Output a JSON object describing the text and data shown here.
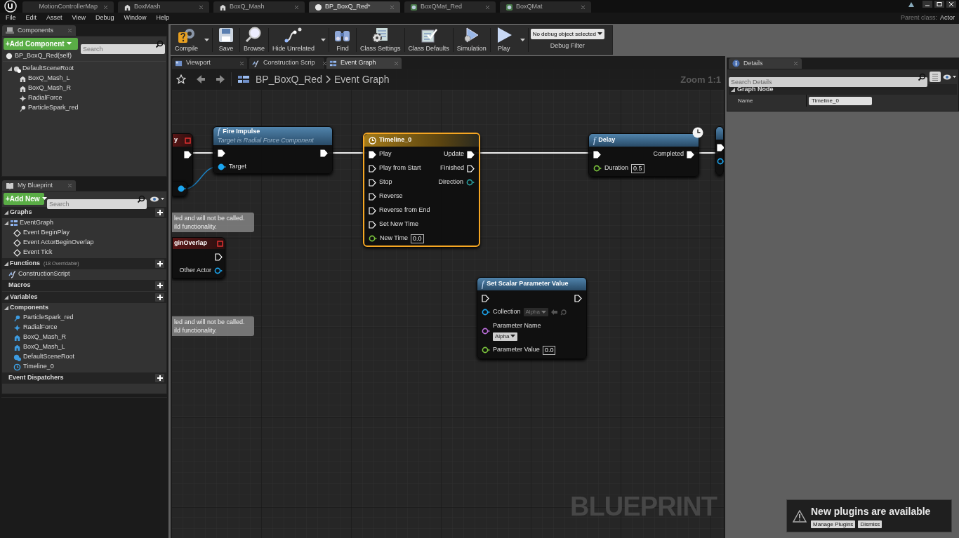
{
  "document_tabs": [
    {
      "label": "MotionControllerMap",
      "kind": "plain",
      "selected": false
    },
    {
      "label": "BoxMash",
      "kind": "mesh",
      "selected": false
    },
    {
      "label": "BoxQ_Mash",
      "kind": "mesh",
      "selected": false
    },
    {
      "label": "BP_BoxQ_Red*",
      "kind": "blueprint",
      "selected": true
    },
    {
      "label": "BoxQMat_Red",
      "kind": "material",
      "selected": false
    },
    {
      "label": "BoxQMat",
      "kind": "material",
      "selected": false
    }
  ],
  "menu": [
    "File",
    "Edit",
    "Asset",
    "View",
    "Debug",
    "Window",
    "Help"
  ],
  "parent_class": {
    "label": "Parent class:",
    "value": "Actor"
  },
  "components_panel": {
    "tab": "Components",
    "add_button": "+Add Component",
    "search_placeholder": "Search",
    "self_item": "BP_BoxQ_Red(self)",
    "tree": [
      {
        "label": "DefaultSceneRoot",
        "kind": "scene",
        "expanded": true,
        "children": [
          {
            "label": "BoxQ_Mash_L",
            "kind": "mesh"
          },
          {
            "label": "BoxQ_Mash_R",
            "kind": "mesh"
          },
          {
            "label": "RadialForce",
            "kind": "force"
          },
          {
            "label": "ParticleSpark_red",
            "kind": "particle"
          }
        ]
      }
    ]
  },
  "my_blueprint": {
    "tab": "My Blueprint",
    "add_button": "+Add New",
    "search_placeholder": "Search",
    "sections": [
      {
        "title": "Graphs",
        "expanded": true,
        "items": [
          {
            "label": "EventGraph",
            "kind": "graph",
            "expanded": true,
            "children": [
              {
                "label": "Event BeginPlay",
                "kind": "event"
              },
              {
                "label": "Event ActorBeginOverlap",
                "kind": "event"
              },
              {
                "label": "Event Tick",
                "kind": "event"
              }
            ]
          }
        ]
      },
      {
        "title": "Functions",
        "note": "(18 Overridable)",
        "expanded": true,
        "items": [
          {
            "label": "ConstructionScript",
            "kind": "function"
          }
        ]
      },
      {
        "title": "Macros"
      },
      {
        "title": "Variables",
        "expanded": true,
        "items": [
          {
            "label": "Components",
            "kind": "category",
            "expanded": true,
            "children": [
              {
                "label": "ParticleSpark_red",
                "kind": "particle"
              },
              {
                "label": "RadialForce",
                "kind": "force"
              },
              {
                "label": "BoxQ_Mash_R",
                "kind": "mesh"
              },
              {
                "label": "BoxQ_Mash_L",
                "kind": "mesh"
              },
              {
                "label": "DefaultSceneRoot",
                "kind": "scene"
              },
              {
                "label": "Timeline_0",
                "kind": "timeline"
              }
            ]
          }
        ]
      },
      {
        "title": "Event Dispatchers"
      }
    ]
  },
  "toolbar": [
    {
      "label": "Compile",
      "kind": "compile",
      "dropdown": true
    },
    {
      "label": "Save",
      "kind": "save",
      "dropdown": false
    },
    {
      "label": "Browse",
      "kind": "browse",
      "dropdown": false
    },
    {
      "label": "Hide Unrelated",
      "kind": "hide",
      "dropdown": true
    },
    {
      "label": "Find",
      "kind": "find",
      "dropdown": false
    },
    {
      "label": "Class Settings",
      "kind": "settings",
      "dropdown": false
    },
    {
      "label": "Class Defaults",
      "kind": "defaults",
      "dropdown": false
    },
    {
      "label": "Simulation",
      "kind": "simulation",
      "dropdown": false
    },
    {
      "label": "Play",
      "kind": "play",
      "dropdown": true
    }
  ],
  "debug_filter": {
    "value": "No debug object selected",
    "label": "Debug Filter"
  },
  "editor_tabs": [
    {
      "label": "Viewport",
      "kind": "viewport",
      "selected": false
    },
    {
      "label": "Construction Scrip",
      "kind": "function",
      "selected": false
    },
    {
      "label": "Event Graph",
      "kind": "graph",
      "selected": true
    }
  ],
  "breadcrumb": {
    "root": "BP_BoxQ_Red",
    "current": "Event Graph"
  },
  "zoom": "Zoom 1:1",
  "graph_nodes": [
    {
      "kind": "event",
      "title": "y",
      "selected": false,
      "rows": [
        {
          "right": {
            "kind": "exec",
            "connected": true
          }
        }
      ]
    },
    {
      "kind": "function",
      "glyph": "f",
      "title": "Fire Impulse",
      "subtitle": "Target is Radial Force Component",
      "selected": false,
      "rows": [
        {
          "left": {
            "kind": "exec",
            "connected": true
          },
          "right": {
            "kind": "exec",
            "connected": true
          }
        },
        {
          "left": {
            "kind": "object",
            "label": "Target",
            "connected": true
          }
        }
      ]
    },
    {
      "kind": "variable",
      "selected": false,
      "rows": [
        {
          "right": {
            "kind": "object",
            "connected": true
          }
        }
      ]
    },
    {
      "kind": "comment",
      "lines": [
        "led and will not be called.",
        "ild functionality."
      ]
    },
    {
      "kind": "event",
      "title": "ginOverlap",
      "selected": false,
      "rows": [
        {
          "right": {
            "kind": "exec",
            "connected": false
          }
        },
        {
          "right": {
            "kind": "object",
            "label": "Other Actor",
            "connected": false
          }
        }
      ]
    },
    {
      "kind": "comment",
      "lines": [
        "led and will not be called.",
        "ild functionality."
      ]
    },
    {
      "kind": "timeline",
      "title": "Timeline_0",
      "selected": true,
      "rows": [
        {
          "left": {
            "kind": "exec",
            "label": "Play",
            "connected": true
          },
          "right": {
            "kind": "exec",
            "label": "Update",
            "connected": true
          }
        },
        {
          "left": {
            "kind": "exec",
            "label": "Play from Start",
            "connected": false
          },
          "right": {
            "kind": "exec",
            "label": "Finished",
            "connected": false
          }
        },
        {
          "left": {
            "kind": "exec",
            "label": "Stop",
            "connected": false
          },
          "right": {
            "kind": "struct",
            "label": "Direction",
            "connected": false
          }
        },
        {
          "left": {
            "kind": "exec",
            "label": "Reverse",
            "connected": false
          }
        },
        {
          "left": {
            "kind": "exec",
            "label": "Reverse from End",
            "connected": false
          }
        },
        {
          "left": {
            "kind": "exec",
            "label": "Set New Time",
            "connected": false
          }
        },
        {
          "left": {
            "kind": "float",
            "label": "New Time",
            "value": "0.0",
            "connected": false
          }
        }
      ]
    },
    {
      "kind": "function",
      "glyph": "f",
      "title": "Delay",
      "latent": true,
      "selected": false,
      "rows": [
        {
          "left": {
            "kind": "exec",
            "connected": true
          },
          "right": {
            "kind": "exec",
            "label": "Completed",
            "connected": true
          }
        },
        {
          "left": {
            "kind": "float",
            "label": "Duration",
            "value": "0.5",
            "connected": false
          }
        }
      ]
    },
    {
      "kind": "function",
      "selected": false,
      "rows": [
        {
          "left": {
            "kind": "exec",
            "connected": true
          }
        },
        {
          "left": {
            "kind": "object",
            "connected": false
          }
        }
      ]
    },
    {
      "kind": "function",
      "glyph": "f",
      "title": "Set Scalar Parameter Value",
      "selected": false,
      "rows": [
        {
          "left": {
            "kind": "exec",
            "connected": false
          },
          "right": {
            "kind": "exec",
            "connected": false
          }
        },
        {
          "left": {
            "kind": "object",
            "label": "Collection",
            "dropdown": "Alpha",
            "disabled": true,
            "connected": false
          }
        },
        {
          "left": {
            "kind": "name",
            "label": "Parameter Name",
            "dropdown": "Alpha",
            "disabled": false,
            "value_below": true,
            "connected": false
          }
        },
        {
          "left": {
            "kind": "float",
            "label": "Parameter Value",
            "value": "0.0",
            "connected": false
          }
        }
      ]
    }
  ],
  "graph_watermark": "BLUEPRINT",
  "details": {
    "tab": "Details",
    "search_placeholder": "Search Details",
    "section": "Graph Node",
    "rows": [
      {
        "label": "Name",
        "value": "Timeline_0"
      }
    ]
  },
  "notification": {
    "title": "New plugins are available",
    "buttons": [
      "Manage Plugins",
      "Dismiss"
    ]
  }
}
